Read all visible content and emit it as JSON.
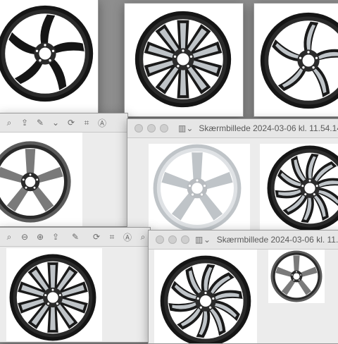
{
  "windows": [
    {
      "id": "w-top-left"
    },
    {
      "id": "w-top-mid"
    },
    {
      "id": "w-top-right"
    },
    {
      "id": "w-mid-left"
    },
    {
      "id": "w-mid-center",
      "title": "Skærmbillede 2024-03-06 kl. 11.54.14"
    },
    {
      "id": "w-bottom-left"
    },
    {
      "id": "w-bottom-center",
      "title": "Skærmbillede 2024-03-06 kl. 11..."
    }
  ],
  "toolbar_icons": [
    "search-icon",
    "zoom-out-icon",
    "zoom-in-icon",
    "share-icon",
    "markup-icon",
    "rotate-icon",
    "annotate-icon"
  ],
  "colors": {
    "rim_dark": "#151515",
    "rim_silver": "#bfc4c8",
    "rim_gunmetal": "#5b5b5b",
    "desktop": "#8e8e8e"
  },
  "wheels": [
    {
      "name": "wheel-black-5spoke",
      "style": "black",
      "spokes": 5
    },
    {
      "name": "wheel-two-tone-10spoke",
      "style": "twotone",
      "spokes": 10
    },
    {
      "name": "wheel-blade-5spoke",
      "style": "twotone",
      "spokes": 5
    },
    {
      "name": "wheel-gunmetal-5spoke",
      "style": "gunmetal",
      "spokes": 5
    },
    {
      "name": "wheel-silver-5spoke",
      "style": "silver",
      "spokes": 5
    },
    {
      "name": "wheel-twist-10spoke",
      "style": "twotone",
      "spokes": 10
    },
    {
      "name": "wheel-two-tone-split",
      "style": "twotone",
      "spokes": 10
    },
    {
      "name": "wheel-turbine-black",
      "style": "twotone",
      "spokes": 10
    },
    {
      "name": "wheel-thumbnail-gunmetal",
      "style": "gunmetal",
      "spokes": 5
    }
  ]
}
